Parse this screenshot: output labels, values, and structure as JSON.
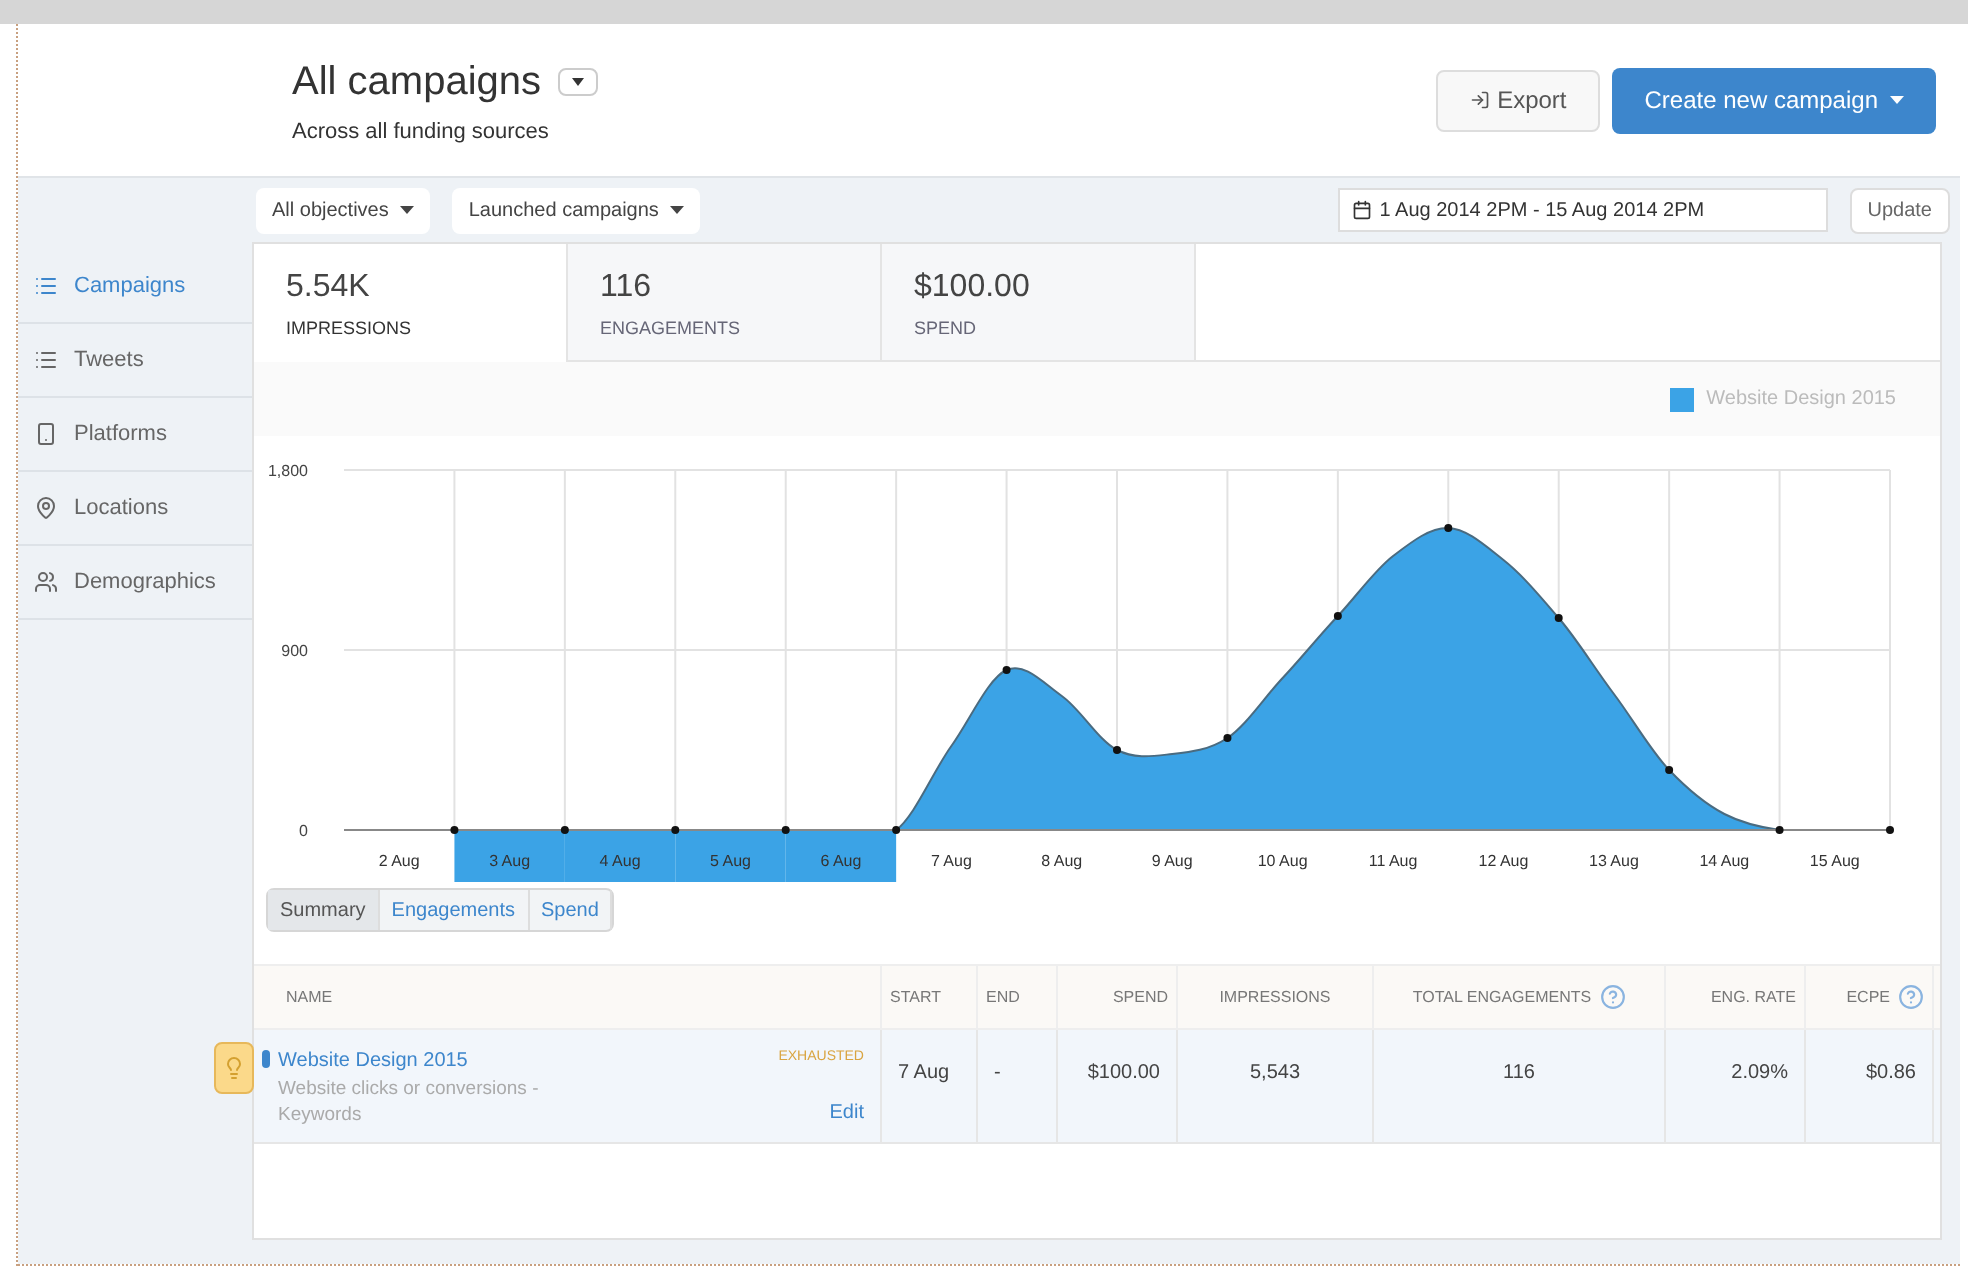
{
  "header": {
    "title": "All campaigns",
    "subtitle": "Across all funding sources",
    "export_button": "Export",
    "create_button": "Create new campaign"
  },
  "filters": {
    "objective": "All objectives",
    "status": "Launched campaigns",
    "date_range": "1 Aug 2014 2PM - 15 Aug 2014 2PM",
    "update_button": "Update"
  },
  "sidebar": {
    "items": [
      {
        "label": "Campaigns",
        "selected": true
      },
      {
        "label": "Tweets",
        "selected": false
      },
      {
        "label": "Platforms",
        "selected": false
      },
      {
        "label": "Locations",
        "selected": false
      },
      {
        "label": "Demographics",
        "selected": false
      }
    ]
  },
  "metric_tabs": [
    {
      "value": "5.54K",
      "label": "IMPRESSIONS",
      "selected": true
    },
    {
      "value": "116",
      "label": "ENGAGEMENTS",
      "selected": false
    },
    {
      "value": "$100.00",
      "label": "SPEND",
      "selected": false
    }
  ],
  "chart_data": {
    "type": "area",
    "categories": [
      "2 Aug",
      null,
      "3 Aug",
      null,
      "4 Aug",
      null,
      "5 Aug",
      null,
      "6 Aug",
      null,
      "7 Aug",
      null,
      "8 Aug",
      null,
      "9 Aug",
      null,
      "10 Aug",
      null,
      "11 Aug",
      null,
      "12 Aug",
      null,
      "13 Aug",
      null,
      "14 Aug",
      null,
      "15 Aug",
      null
    ],
    "series": [
      {
        "name": "Website Design 2015",
        "color": "#3ba3e6",
        "values": [
          0,
          0,
          0,
          0,
          0,
          0,
          0,
          0,
          0,
          0,
          420,
          800,
          670,
          400,
          380,
          460,
          760,
          1070,
          1370,
          1510,
          1350,
          1060,
          680,
          300,
          80,
          0,
          0,
          0
        ]
      }
    ],
    "ylim": [
      0,
      1800
    ],
    "yticks": [
      0,
      900,
      {
        "value": 1800,
        "label": "1,800"
      }
    ],
    "grid": true
  },
  "chart_date_selection": [
    {
      "selected": false
    },
    {
      "selected": true
    },
    {
      "selected": true
    },
    {
      "selected": true
    },
    {
      "selected": true
    },
    {
      "selected": false
    },
    {
      "selected": false
    },
    {
      "selected": false
    },
    {
      "selected": false
    },
    {
      "selected": false
    },
    {
      "selected": false
    },
    {
      "selected": false
    },
    {
      "selected": false
    },
    {
      "selected": false
    }
  ],
  "chart_tabs": [
    {
      "label": "Summary",
      "selected": true
    },
    {
      "label": "Engagements",
      "selected": false
    },
    {
      "label": "Spend",
      "selected": false
    }
  ],
  "table": {
    "columns": [
      {
        "label": "NAME",
        "help": false
      },
      {
        "label": "START",
        "help": false
      },
      {
        "label": "END",
        "help": false
      },
      {
        "label": "SPEND",
        "help": false
      },
      {
        "label": "IMPRESSIONS",
        "help": false
      },
      {
        "label": "TOTAL ENGAGEMENTS",
        "help": true
      },
      {
        "label": "ENG. RATE",
        "help": false
      },
      {
        "label": "ECPE",
        "help": true
      }
    ],
    "rows": [
      {
        "cells": [
          {
            "name": "Website Design 2015",
            "objective": "Website clicks or conversions - Keywords",
            "status": "EXHAUSTED",
            "edit": "Edit"
          },
          "7 Aug",
          "-",
          "$100.00",
          "5,543",
          "116",
          "2.09%",
          "$0.86"
        ]
      }
    ]
  }
}
